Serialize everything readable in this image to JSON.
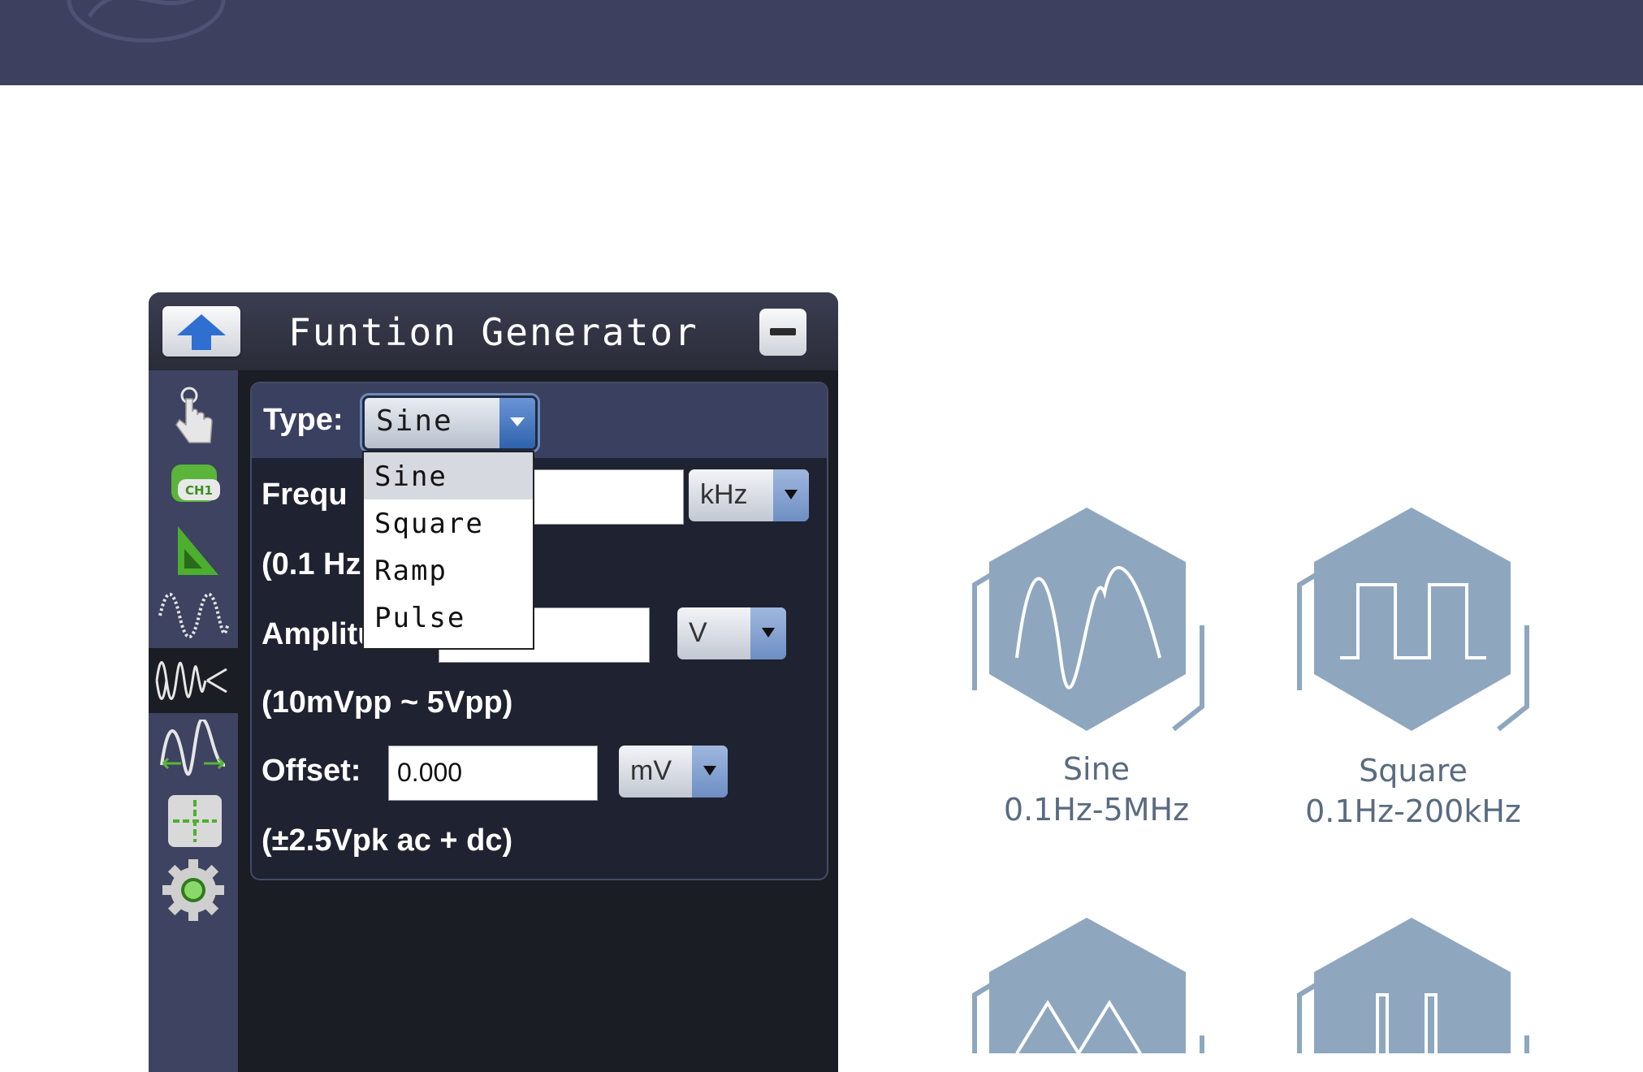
{
  "generator": {
    "title": "Funtion Generator",
    "type_label": "Type:",
    "type_value": "Sine",
    "type_options": [
      "Sine",
      "Square",
      "Ramp",
      "Pulse"
    ],
    "frequency_label": "Frequ",
    "frequency_range": "(0.1 Hz",
    "frequency_unit": "kHz",
    "amplitude_label": "Amplitu",
    "amplitude_range": "(10mVpp ~ 5Vpp)",
    "amplitude_unit": "V",
    "offset_label": "Offset:",
    "offset_value": "0.000",
    "offset_unit": "mV",
    "offset_range": "(±2.5Vpk ac + dc)"
  },
  "waveforms": [
    {
      "name": "Sine",
      "range": "0.1Hz-5MHz",
      "icon": "sine-wave-icon"
    },
    {
      "name": "Square",
      "range": "0.1Hz-200kHz",
      "icon": "square-wave-icon"
    },
    {
      "name": "",
      "range": "",
      "icon": "ramp-wave-icon"
    },
    {
      "name": "",
      "range": "",
      "icon": "pulse-wave-icon"
    }
  ],
  "sidebar_icons": [
    "touch-icon",
    "channel-icon",
    "ruler-icon",
    "sine-mode-icon",
    "sweep-icon",
    "wave-mode-icon",
    "cursor-icon",
    "settings-icon"
  ],
  "colors": {
    "topbar": "#3d405e",
    "panel": "#1b1d24",
    "sidebar": "#3d4360",
    "hexagon": "#8ea7bf",
    "wave_text": "#596b80"
  }
}
